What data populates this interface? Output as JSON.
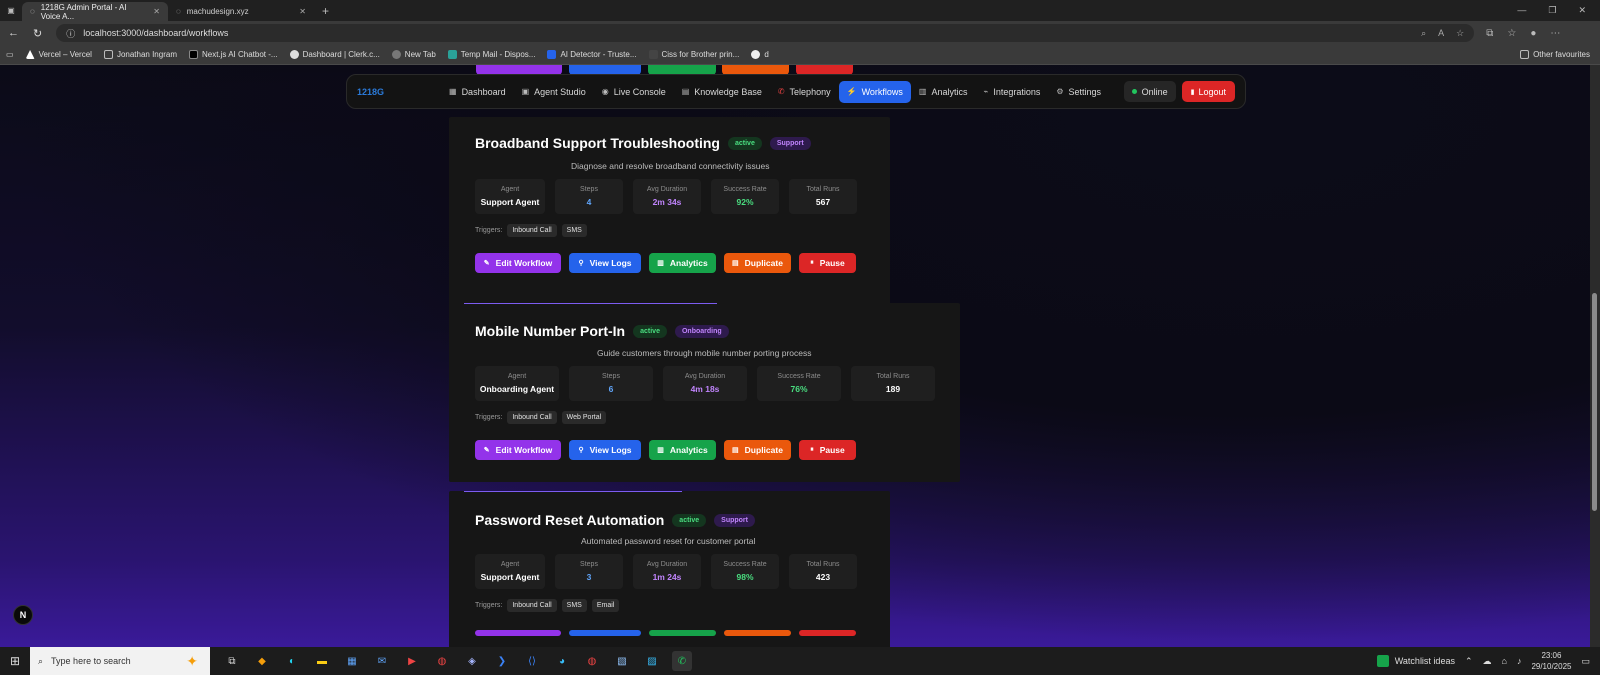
{
  "browser": {
    "tabs": [
      {
        "title": "1218G Admin Portal - AI Voice A...",
        "active": true
      },
      {
        "title": "machudesign.xyz",
        "active": false
      }
    ],
    "url": "localhost:3000/dashboard/workflows",
    "bookmarks": [
      "Vercel – Vercel",
      "Jonathan Ingram",
      "Next.js AI Chatbot -...",
      "Dashboard | Clerk.c...",
      "New Tab",
      "Temp Mail - Dispos...",
      "AI Detector - Truste...",
      "Ciss for Brother prin...",
      "d"
    ],
    "other_favourites": "Other favourites"
  },
  "nav": {
    "logo": "1218G",
    "items": [
      {
        "label": "Dashboard",
        "icon": "▦"
      },
      {
        "label": "Agent Studio",
        "icon": "▣"
      },
      {
        "label": "Live Console",
        "icon": "◉"
      },
      {
        "label": "Knowledge Base",
        "icon": "▤"
      },
      {
        "label": "Telephony",
        "icon": "✆"
      },
      {
        "label": "Workflows",
        "icon": "⚡"
      },
      {
        "label": "Analytics",
        "icon": "▥"
      },
      {
        "label": "Integrations",
        "icon": "⌁"
      },
      {
        "label": "Settings",
        "icon": "⚙"
      }
    ],
    "status": "Online",
    "logout": "Logout"
  },
  "labels": {
    "agent": "Agent",
    "steps": "Steps",
    "avg": "Avg Duration",
    "success": "Success Rate",
    "runs": "Total Runs",
    "triggers": "Triggers:"
  },
  "buttons": {
    "edit": "Edit Workflow",
    "logs": "View Logs",
    "analytics": "Analytics",
    "duplicate": "Duplicate",
    "pause": "Pause"
  },
  "workflows": [
    {
      "title": "Broadband Support Troubleshooting",
      "status": "active",
      "category": "Support",
      "description": "Diagnose and resolve broadband connectivity issues",
      "agent": "Support Agent",
      "steps": "4",
      "avg": "2m 34s",
      "success": "92%",
      "runs": "567",
      "triggers": [
        "Inbound Call",
        "SMS"
      ]
    },
    {
      "title": "Mobile Number Port-In",
      "status": "active",
      "category": "Onboarding",
      "description": "Guide customers through mobile number porting process",
      "agent": "Onboarding Agent",
      "steps": "6",
      "avg": "4m 18s",
      "success": "76%",
      "runs": "189",
      "triggers": [
        "Inbound Call",
        "Web Portal"
      ]
    },
    {
      "title": "Password Reset Automation",
      "status": "active",
      "category": "Support",
      "description": "Automated password reset for customer portal",
      "agent": "Support Agent",
      "steps": "3",
      "avg": "1m 24s",
      "success": "98%",
      "runs": "423",
      "triggers": [
        "Inbound Call",
        "SMS",
        "Email"
      ]
    }
  ],
  "nextjs_badge": "N",
  "taskbar": {
    "search_placeholder": "Type here to search",
    "watchlist": "Watchlist ideas",
    "time": "23:06",
    "date": "29/10/2025"
  }
}
